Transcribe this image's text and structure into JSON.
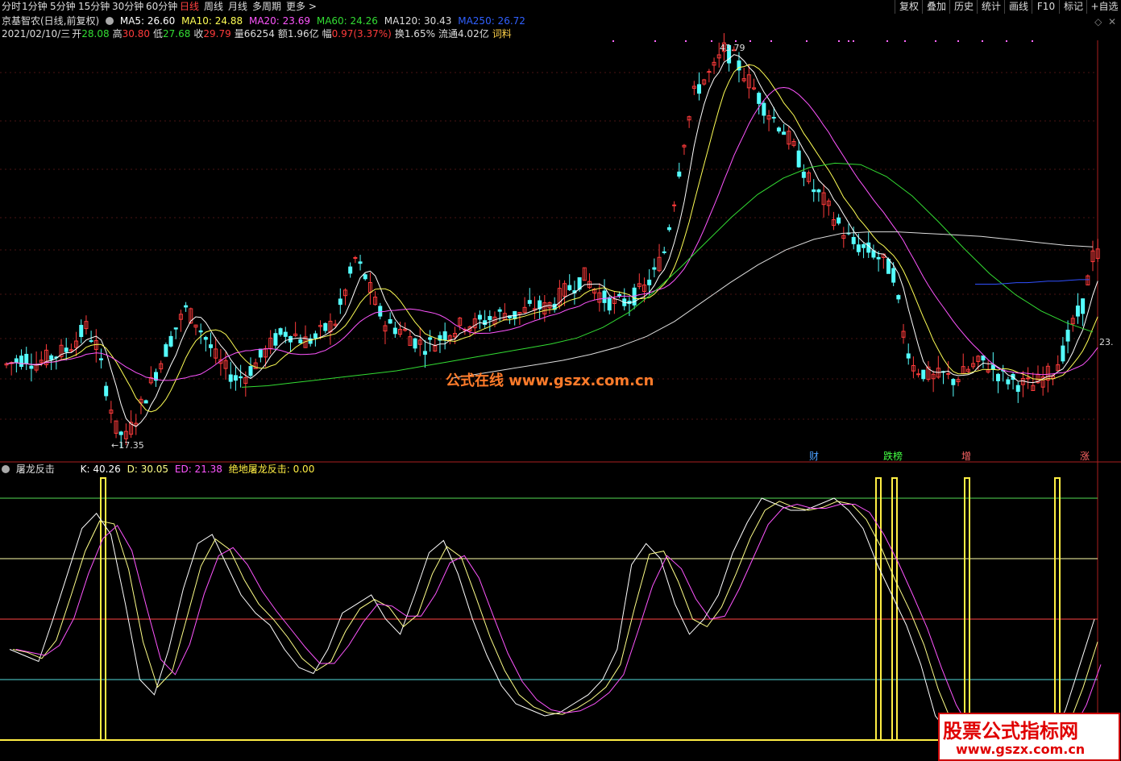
{
  "toolbar": {
    "periods": [
      "分时",
      "1分钟",
      "5分钟",
      "15分钟",
      "30分钟",
      "60分钟",
      "日线",
      "周线",
      "月线",
      "多周期",
      "更多 >"
    ],
    "active_index": 6,
    "right_buttons": [
      "复权",
      "叠加",
      "历史",
      "统计",
      "画线",
      "F10",
      "标记",
      "+自选"
    ]
  },
  "stock_info": {
    "name": "京基智农(日线,前复权)",
    "ma5": "MA5: 26.60",
    "ma10": "MA10: 24.88",
    "ma20": "MA20: 23.69",
    "ma60": "MA60: 24.26",
    "ma120": "MA120: 30.43",
    "ma250": "MA250: 26.72",
    "date": "2021/02/10/三",
    "open_label": "开",
    "open": "28.08",
    "high_label": "高",
    "high": "30.80",
    "low_label": "低",
    "low": "27.68",
    "close_label": "收",
    "close": "29.79",
    "volume": "量66254",
    "amount": "额1.96亿",
    "change_label": "幅",
    "change": "0.97(3.37%)",
    "turnover": "换1.65%",
    "float": "流通4.02亿",
    "extra": "词料"
  },
  "price_annotations": {
    "high_mark": "43.79",
    "low_mark": "17.35",
    "right_price": "23."
  },
  "event_markers": [
    "财",
    "跌榜",
    "增",
    "涨"
  ],
  "indicator": {
    "name": "屠龙反击",
    "k": "K: 40.26",
    "d": "D: 30.05",
    "ed": "ED: 21.38",
    "signal": "绝地屠龙反击: 0.00"
  },
  "watermarks": {
    "center": "公式在线  www.gszx.com.cn",
    "corner_title": "股票公式指标网",
    "corner_url": "www.gszx.com.cn"
  },
  "colors": {
    "up": "#ff3b3b",
    "down": "#54ffff",
    "ma5": "#ffffff",
    "ma10": "#ffff55",
    "ma20": "#ff55ff",
    "ma60": "#33dd33",
    "ma120": "#dddddd",
    "ma250": "#3050ff",
    "kline": "#ffffff",
    "dline": "#ffff88",
    "edline": "#ff55ff",
    "signal": "#ffee44"
  },
  "chart_data": [
    {
      "type": "candlestick",
      "title": "京基智农(日线,前复权)",
      "price_range": [
        17.35,
        43.79
      ],
      "series_ma": [
        {
          "name": "MA5",
          "last": 26.6
        },
        {
          "name": "MA10",
          "last": 24.88
        },
        {
          "name": "MA20",
          "last": 23.69
        },
        {
          "name": "MA60",
          "last": 24.26
        },
        {
          "name": "MA120",
          "last": 30.43
        },
        {
          "name": "MA250",
          "last": 26.72
        }
      ],
      "price_path": [
        22.5,
        22.8,
        23.0,
        22.6,
        22.9,
        23.2,
        23.5,
        24.2,
        25.0,
        23.8,
        21.0,
        18.2,
        17.6,
        19.0,
        20.5,
        22.0,
        23.5,
        25.0,
        26.2,
        25.4,
        24.3,
        23.0,
        22.2,
        21.6,
        21.8,
        22.6,
        23.4,
        24.2,
        24.7,
        24.5,
        24.1,
        24.3,
        24.9,
        25.4,
        27.4,
        29.6,
        28.4,
        26.6,
        25.3,
        25.0,
        24.7,
        24.1,
        23.8,
        24.0,
        24.6,
        24.9,
        25.3,
        25.2,
        25.5,
        25.7,
        26.0,
        25.8,
        26.1,
        26.4,
        26.3,
        26.7,
        27.4,
        27.9,
        28.4,
        27.6,
        26.9,
        26.6,
        26.7,
        27.1,
        27.6,
        28.6,
        30.1,
        33.6,
        37.6,
        40.6,
        41.6,
        42.3,
        43.6,
        43.0,
        42.0,
        41.0,
        39.8,
        39.0,
        38.2,
        37.0,
        35.5,
        34.2,
        33.5,
        32.4,
        31.4,
        30.6,
        30.3,
        30.0,
        29.4,
        28.6,
        24.6,
        22.4,
        22.0,
        21.6,
        21.8,
        21.5,
        21.9,
        22.4,
        22.7,
        22.2,
        21.7,
        21.4,
        21.2,
        21.1,
        21.6,
        22.1,
        23.3,
        25.2,
        26.5,
        29.8
      ],
      "ma60_path": [
        21.0,
        21.1,
        21.3,
        21.5,
        21.7,
        21.9,
        22.1,
        22.4,
        22.7,
        23.0,
        23.3,
        23.6,
        23.9,
        24.3,
        25.0,
        26.0,
        27.4,
        29.0,
        30.7,
        32.4,
        33.9,
        35.0,
        35.7,
        36.0,
        35.9,
        35.1,
        33.8,
        32.1,
        30.3,
        28.6,
        27.2,
        26.1,
        25.3,
        24.7
      ],
      "ma120_path": [
        21.6,
        21.9,
        22.2,
        22.5,
        22.8,
        23.2,
        23.7,
        24.4,
        25.4,
        26.7,
        28.0,
        29.2,
        30.2,
        30.9,
        31.3,
        31.4,
        31.4,
        31.3,
        31.2,
        31.1,
        30.9,
        30.7,
        30.5,
        30.4
      ],
      "ma250_path": [
        27.9,
        27.9,
        27.9,
        27.95,
        28.0,
        28.0,
        28.05,
        28.1,
        28.1,
        28.15,
        28.2,
        28.2
      ],
      "markers": [
        "财",
        "跌榜",
        "增",
        "涨"
      ]
    },
    {
      "type": "line",
      "title": "屠龙反击",
      "series": [
        {
          "name": "K",
          "last": 40.26
        },
        {
          "name": "D",
          "last": 30.05
        },
        {
          "name": "ED",
          "last": 21.38
        },
        {
          "name": "绝地屠龙反击",
          "last": 0.0
        }
      ],
      "k_path": [
        30,
        28,
        26,
        40,
        55,
        70,
        75,
        68,
        45,
        20,
        15,
        30,
        50,
        65,
        68,
        58,
        48,
        42,
        38,
        30,
        24,
        22,
        30,
        42,
        45,
        48,
        40,
        35,
        48,
        62,
        66,
        55,
        40,
        28,
        18,
        12,
        10,
        8,
        9,
        12,
        15,
        20,
        30,
        58,
        65,
        60,
        45,
        35,
        40,
        48,
        62,
        72,
        80,
        78,
        76,
        76,
        78,
        80,
        76,
        70,
        58,
        48,
        38,
        25,
        8,
        2,
        0,
        -2,
        -3,
        -4,
        -3,
        -2,
        0,
        10,
        25,
        40
      ],
      "signal_spikes": [
        128,
        1090,
        1110,
        1200,
        1312
      ],
      "ref_lines": [
        0,
        20,
        40,
        60,
        80
      ]
    }
  ]
}
